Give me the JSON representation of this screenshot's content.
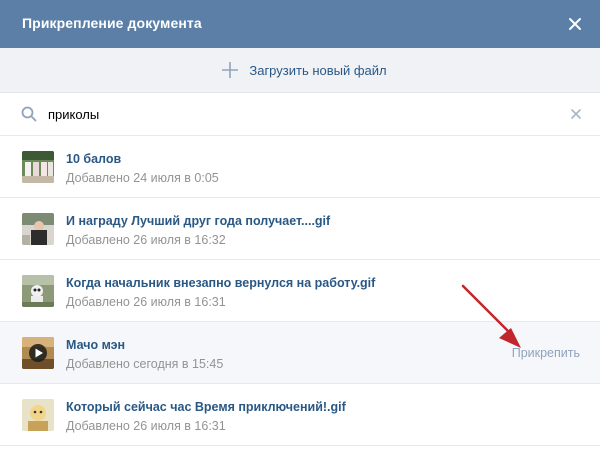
{
  "dialog": {
    "title": "Прикрепление документа"
  },
  "upload": {
    "label": "Загрузить новый файл"
  },
  "search": {
    "value": "приколы"
  },
  "documents": [
    {
      "title": "10 балов",
      "meta": "Добавлено 24 июля в 0:05"
    },
    {
      "title": "И награду Лучший друг года получает....gif",
      "meta": "Добавлено 26 июля в 16:32"
    },
    {
      "title": "Когда начальник внезапно вернулся на работу.gif",
      "meta": "Добавлено 26 июля в 16:31"
    },
    {
      "title": "Мачо мэн",
      "meta": "Добавлено сегодня в 15:45",
      "action": "Прикрепить"
    },
    {
      "title": "Который сейчас час Время приключений!.gif",
      "meta": "Добавлено 26 июля в 16:31"
    }
  ],
  "colors": {
    "header_bg": "#5b7fa6",
    "link": "#2a5885",
    "meta": "#939393",
    "attach_link": "#8fa3bc",
    "annotation_arrow": "#c0262b"
  }
}
